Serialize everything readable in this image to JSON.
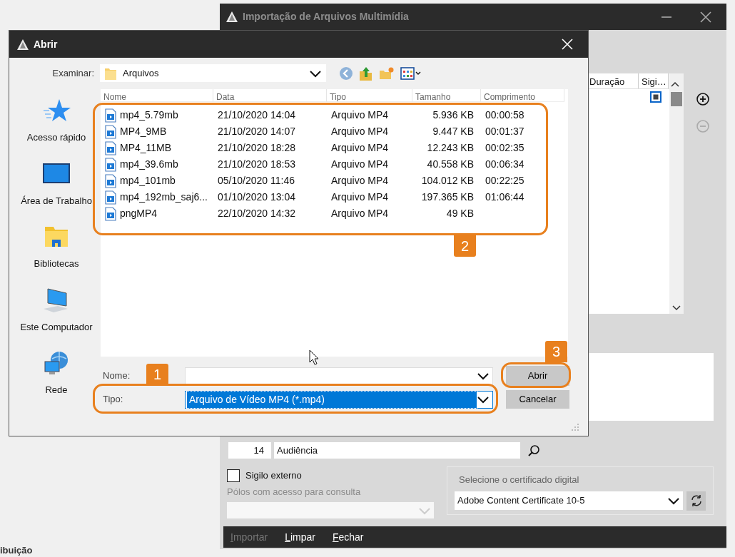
{
  "behind_text": "ibuição",
  "main_window": {
    "title": "Importação de Arquivos Multimídia",
    "active": false,
    "table": {
      "columns": [
        "Duração",
        "Sigi…"
      ],
      "rows": [
        {
          "checked": true
        }
      ]
    },
    "row_buttons": [
      {
        "kind": "add",
        "disabled": false
      },
      {
        "kind": "remove",
        "disabled": true
      }
    ],
    "category": {
      "code": "14",
      "name": "Audiência"
    },
    "external_secrecy": {
      "label": "Sigilo externo",
      "checked": false
    },
    "access_parties": {
      "label": "Pólos com acesso para consulta",
      "disabled": true
    },
    "certificate": {
      "legend": "Selecione o certificado digital",
      "value": "Adobe Content Certificate 10-5"
    },
    "footer_buttons": [
      {
        "label": "Importar",
        "disabled": true
      },
      {
        "label": "Limpar",
        "disabled": false
      },
      {
        "label": "Fechar",
        "disabled": false
      }
    ]
  },
  "dialog": {
    "title": "Abrir",
    "active": true,
    "look_in_label": "Examinar:",
    "look_in_value": "Arquivos",
    "places": [
      {
        "label": "Acesso rápido",
        "kind": "star"
      },
      {
        "label": "Área de Trabalho",
        "kind": "desktop"
      },
      {
        "label": "Bibliotecas",
        "kind": "libraries"
      },
      {
        "label": "Este Computador",
        "kind": "computer"
      },
      {
        "label": "Rede",
        "kind": "network"
      }
    ],
    "columns": [
      "Nome",
      "Data",
      "Tipo",
      "Tamanho",
      "Comprimento"
    ],
    "files": [
      {
        "name": "mp4_5.79mb",
        "date": "21/10/2020 14:04",
        "type": "Arquivo MP4",
        "size": "5.936 KB",
        "length": "00:00:58"
      },
      {
        "name": "MP4_9MB",
        "date": "21/10/2020 14:07",
        "type": "Arquivo MP4",
        "size": "9.447 KB",
        "length": "00:01:37"
      },
      {
        "name": "MP4_11MB",
        "date": "21/10/2020 18:28",
        "type": "Arquivo MP4",
        "size": "12.243 KB",
        "length": "00:02:35"
      },
      {
        "name": "mp4_39.6mb",
        "date": "21/10/2020 18:53",
        "type": "Arquivo MP4",
        "size": "40.558 KB",
        "length": "00:06:34"
      },
      {
        "name": "mp4_101mb",
        "date": "05/10/2020 11:46",
        "type": "Arquivo MP4",
        "size": "104.012 KB",
        "length": "00:22:25"
      },
      {
        "name": "mp4_192mb_saj6...",
        "date": "01/10/2020 13:04",
        "type": "Arquivo MP4",
        "size": "197.365 KB",
        "length": "01:06:44"
      },
      {
        "name": "pngMP4",
        "date": "22/10/2020 14:32",
        "type": "Arquivo MP4",
        "size": "49 KB"
      }
    ],
    "name_label": "Nome:",
    "type_label": "Tipo:",
    "type_value": "Arquivo de Vídeo MP4 (*.mp4)",
    "type_value_selected": true,
    "buttons": [
      {
        "label": "Abrir"
      },
      {
        "label": "Cancelar"
      }
    ]
  },
  "annotations": [
    {
      "number": "1"
    },
    {
      "number": "2"
    },
    {
      "number": "3"
    }
  ]
}
